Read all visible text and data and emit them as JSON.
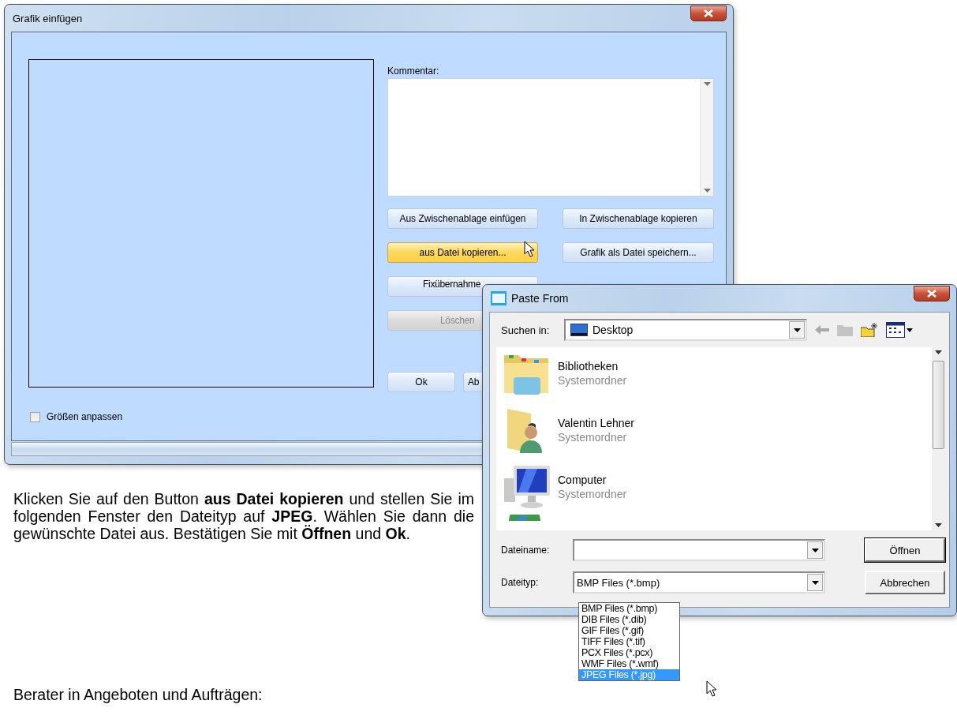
{
  "main_window": {
    "title": "Grafik einfügen",
    "comment_label": "Kommentar:",
    "button_rows": [
      [
        {
          "label": "Aus Zwischenablage einfügen",
          "highlighted": false,
          "disabled": false
        },
        {
          "label": "In Zwischenablage kopieren",
          "highlighted": false,
          "disabled": false
        }
      ],
      [
        {
          "label": "aus Datei kopieren...",
          "highlighted": true,
          "disabled": false
        },
        {
          "label": "Grafik als Datei speichern...",
          "highlighted": false,
          "disabled": false
        }
      ],
      [
        {
          "label": "Fixübernahme",
          "highlighted": false,
          "disabled": false
        }
      ],
      [
        {
          "label": "Löschen",
          "highlighted": false,
          "disabled": true
        }
      ]
    ],
    "bottom_buttons": [
      "Ok",
      "Ab"
    ],
    "checkbox": {
      "label": "Größen anpassen",
      "checked": false
    }
  },
  "paste_dialog": {
    "title": "Paste From",
    "look_in": {
      "label": "Suchen in:",
      "value": "Desktop"
    },
    "items": [
      {
        "name": "Bibliotheken",
        "type": "Systemordner",
        "kind": "library"
      },
      {
        "name": "Valentin Lehner",
        "type": "Systemordner",
        "kind": "user"
      },
      {
        "name": "Computer",
        "type": "Systemordner",
        "kind": "computer"
      }
    ],
    "file_name": {
      "label": "Dateiname:"
    },
    "file_type": {
      "label": "Dateityp:",
      "value": "BMP Files (*.bmp)"
    },
    "file_type_options": [
      {
        "label": "BMP Files (*.bmp)",
        "selected": false
      },
      {
        "label": "DIB Files (*.dib)",
        "selected": false
      },
      {
        "label": "GIF Files (*.gif)",
        "selected": false
      },
      {
        "label": "TIFF Files (*.tif)",
        "selected": false
      },
      {
        "label": "PCX Files (*.pcx)",
        "selected": false
      },
      {
        "label": "WMF Files (*.wmf)",
        "selected": false
      },
      {
        "label": "JPEG Files (*.jpg)",
        "selected": true
      }
    ],
    "buttons": [
      "Öffnen",
      "Abbrechen"
    ]
  },
  "document": {
    "paragraph": "Klicken Sie auf den Button **aus Datei kopieren** und stellen Sie im folgenden Fenster den Dateityp auf **JPEG**. Wählen Sie dann die gewünschte Datei aus. Bestätigen Sie mit **Öffnen** und **Ok**.",
    "caption": "Berater in Angeboten und Aufträgen:"
  }
}
